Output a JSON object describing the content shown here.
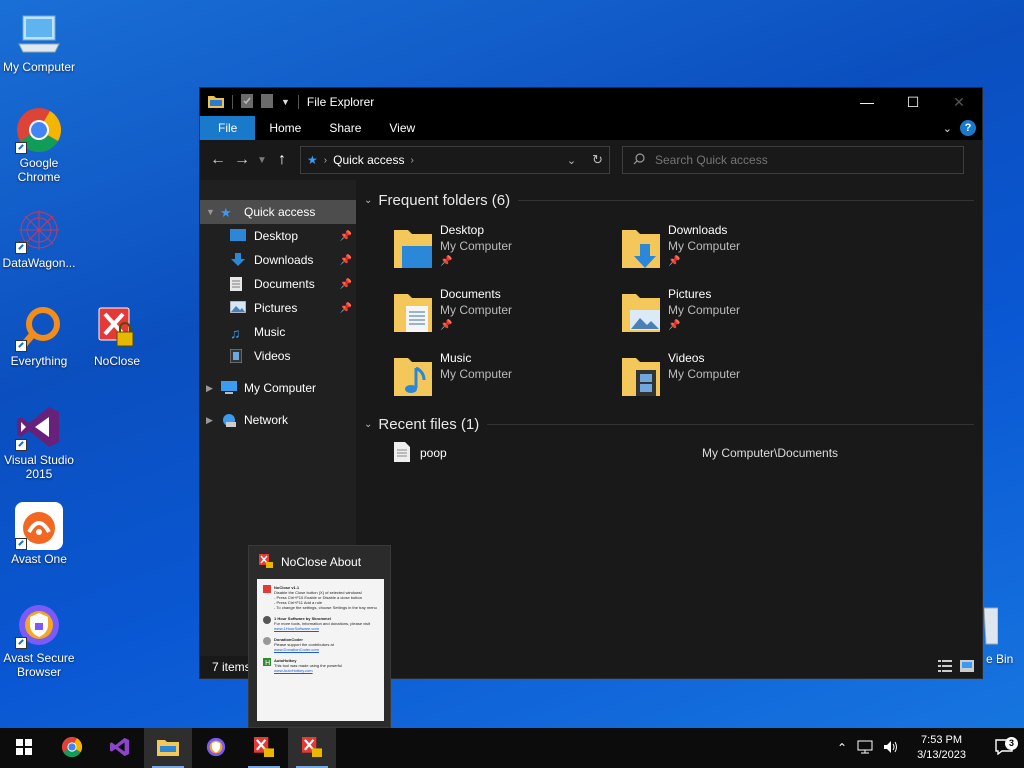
{
  "desktop": {
    "icons": [
      {
        "label": "My Computer"
      },
      {
        "label": "Google Chrome"
      },
      {
        "label": "DataWagon..."
      },
      {
        "label": "Everything"
      },
      {
        "label": "NoClose"
      },
      {
        "label": "Visual Studio 2015"
      },
      {
        "label": "Avast One"
      },
      {
        "label": "Avast Secure Browser"
      }
    ],
    "bin_label": "e Bin"
  },
  "explorer": {
    "title": "File Explorer",
    "tabs": {
      "file": "File",
      "home": "Home",
      "share": "Share",
      "view": "View"
    },
    "help": "?",
    "address": {
      "path": "Quick access"
    },
    "search": {
      "placeholder": "Search Quick access"
    },
    "sidebar": {
      "quick_access": "Quick access",
      "items": [
        "Desktop",
        "Downloads",
        "Documents",
        "Pictures",
        "Music",
        "Videos"
      ],
      "my_computer": "My Computer",
      "network": "Network"
    },
    "frequent": {
      "header": "Frequent folders (6)",
      "folders": [
        {
          "name": "Desktop",
          "location": "My Computer"
        },
        {
          "name": "Downloads",
          "location": "My Computer"
        },
        {
          "name": "Documents",
          "location": "My Computer"
        },
        {
          "name": "Pictures",
          "location": "My Computer"
        },
        {
          "name": "Music",
          "location": "My Computer"
        },
        {
          "name": "Videos",
          "location": "My Computer"
        }
      ]
    },
    "recent": {
      "header": "Recent files (1)",
      "files": [
        {
          "name": "poop",
          "path": "My Computer\\Documents"
        }
      ]
    },
    "status": {
      "items": "7 items"
    }
  },
  "popup": {
    "title": "NoClose About",
    "thumb": {
      "b1_title": "NoClose v1.1",
      "b1_l1": "Disable the Close button (X) of selected windows!",
      "b1_l2": "- Press Ctrl+F10 Enable or Disable a close button",
      "b1_l3": "- Press Ctrl+F11 Add a rule",
      "b1_l4": "- To change the settings, choose Settings in the tray menu",
      "b2_title": "1 Hour Software by Skrommel",
      "b2_l1": "For more tools, information and donations, please visit",
      "b2_link": "www.1HourSoftware.com",
      "b3_title": "DonationCoder",
      "b3_l1": "Please support the contributors at",
      "b3_link": "www.DonationCoder.com",
      "b4_title": "AutoHotkey",
      "b4_l1": "This tool was made using the powerful",
      "b4_link": "www.AutoHotkey.com"
    }
  },
  "taskbar": {
    "time": "7:53 PM",
    "date": "3/13/2023",
    "notifications": "3"
  }
}
